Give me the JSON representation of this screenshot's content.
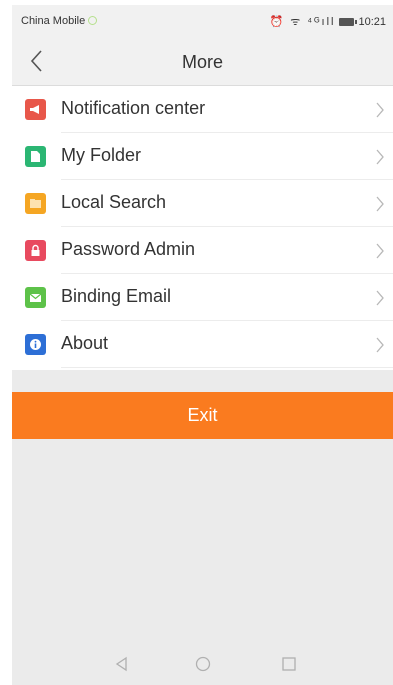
{
  "status_bar": {
    "carrier": "China Mobile",
    "icons": "⏰ ᯤ ⁴ᴳıll",
    "time": "10:21"
  },
  "header": {
    "title": "More"
  },
  "menu": {
    "items": [
      {
        "label": "Notification center",
        "icon": "megaphone-icon",
        "color": "#e8574a"
      },
      {
        "label": "My Folder",
        "icon": "document-icon",
        "color": "#2bb673"
      },
      {
        "label": "Local Search",
        "icon": "folder-icon",
        "color": "#f5a623"
      },
      {
        "label": "Password Admin",
        "icon": "lock-icon",
        "color": "#e84a5f"
      },
      {
        "label": "Binding Email",
        "icon": "mail-icon",
        "color": "#5dc249"
      },
      {
        "label": "About",
        "icon": "info-icon",
        "color": "#2d6fd6"
      }
    ]
  },
  "exit": {
    "label": "Exit",
    "color": "#fa7b1f"
  },
  "system_nav": {
    "icons": [
      "back-triangle-icon",
      "home-circle-icon",
      "recents-square-icon"
    ]
  }
}
